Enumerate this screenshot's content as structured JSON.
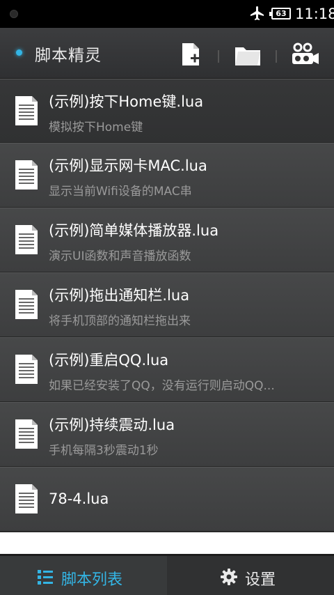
{
  "status_bar": {
    "time": "11:18",
    "battery": "63",
    "icons": [
      "status-dot-icon",
      "airplane-icon",
      "battery-icon"
    ]
  },
  "app_bar": {
    "title": "脚本精灵",
    "accent_color": "#33b5e5",
    "actions": [
      {
        "name": "new-file-icon",
        "label": "新建"
      },
      {
        "name": "folder-icon",
        "label": "打开"
      },
      {
        "name": "record-icon",
        "label": "录制"
      }
    ]
  },
  "scripts": [
    {
      "title": "(示例)按下Home键.lua",
      "subtitle": "模拟按下Home键"
    },
    {
      "title": "(示例)显示网卡MAC.lua",
      "subtitle": "显示当前Wifi设备的MAC串"
    },
    {
      "title": "(示例)简单媒体播放器.lua",
      "subtitle": "演示UI函数和声音播放函数"
    },
    {
      "title": "(示例)拖出通知栏.lua",
      "subtitle": "将手机顶部的通知栏拖出来"
    },
    {
      "title": "(示例)重启QQ.lua",
      "subtitle": "如果已经安装了QQ，没有运行则启动QQ..."
    },
    {
      "title": "(示例)持续震动.lua",
      "subtitle": "手机每隔3秒震动1秒"
    },
    {
      "title": "78-4.lua",
      "subtitle": ""
    }
  ],
  "bottom_tabs": [
    {
      "label": "脚本列表",
      "icon": "list-icon",
      "active": true
    },
    {
      "label": "设置",
      "icon": "gear-icon",
      "active": false
    }
  ]
}
